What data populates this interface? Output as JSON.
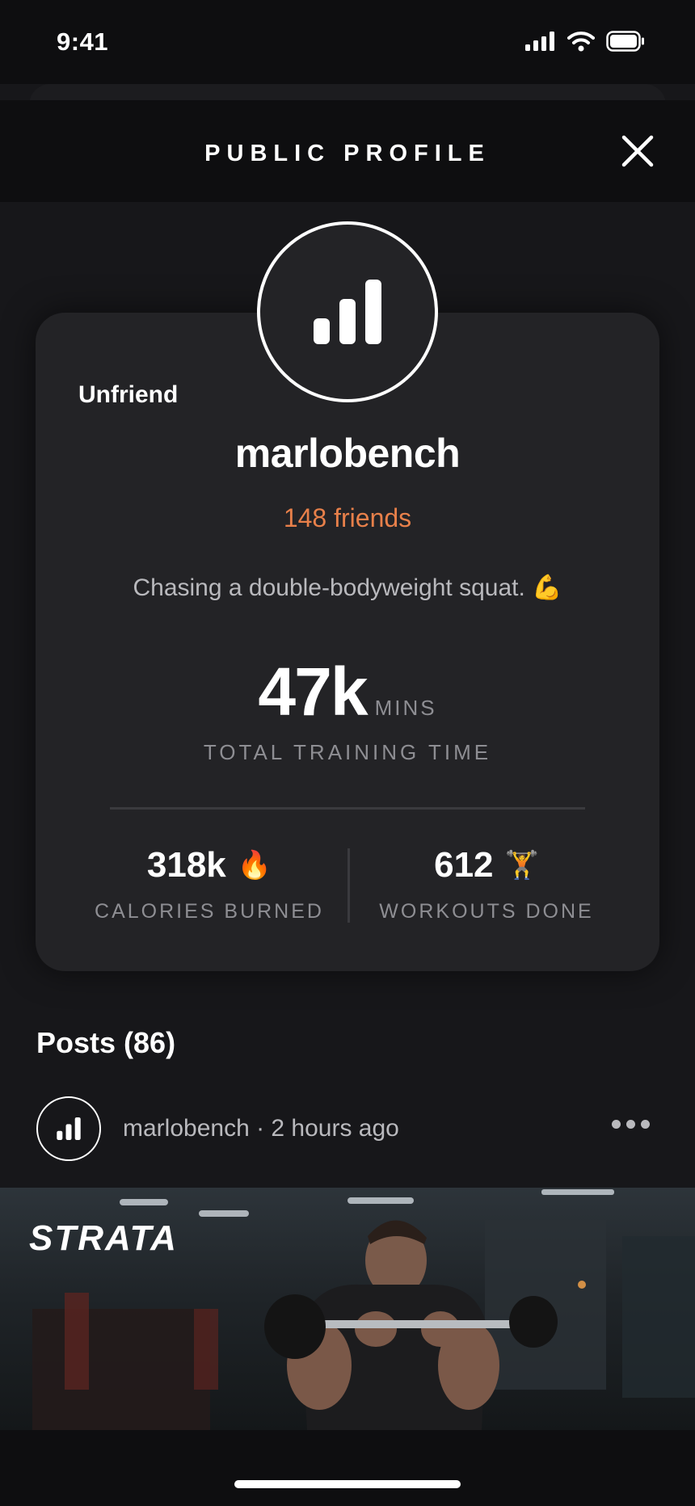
{
  "status": {
    "time": "9:41"
  },
  "header": {
    "title": "PUBLIC PROFILE"
  },
  "profile": {
    "action": "Unfriend",
    "username": "marlobench",
    "friends": "148 friends",
    "bio": "Chasing a double-bodyweight squat. 💪",
    "total": {
      "value": "47k",
      "unit": "MINS",
      "label": "TOTAL TRAINING TIME"
    },
    "calories": {
      "value": "318k",
      "emoji": "🔥",
      "label": "CALORIES BURNED"
    },
    "workouts": {
      "value": "612",
      "emoji": "🏋️",
      "label": "WORKOUTS DONE"
    }
  },
  "posts": {
    "title": "Posts (86)",
    "items": [
      {
        "author_meta": "marlobench · 2 hours ago",
        "brand": "STRATA",
        "image": "man-curling-barbell-in-gym"
      }
    ]
  },
  "icons": {
    "avatar": "bar-chart-icon",
    "close": "close-icon",
    "more": "more-horizontal-icon",
    "status": [
      "signal-icon",
      "wifi-icon",
      "battery-icon"
    ]
  },
  "colors": {
    "accent": "#e8804a",
    "card": "#232326",
    "background": "#17171a"
  }
}
